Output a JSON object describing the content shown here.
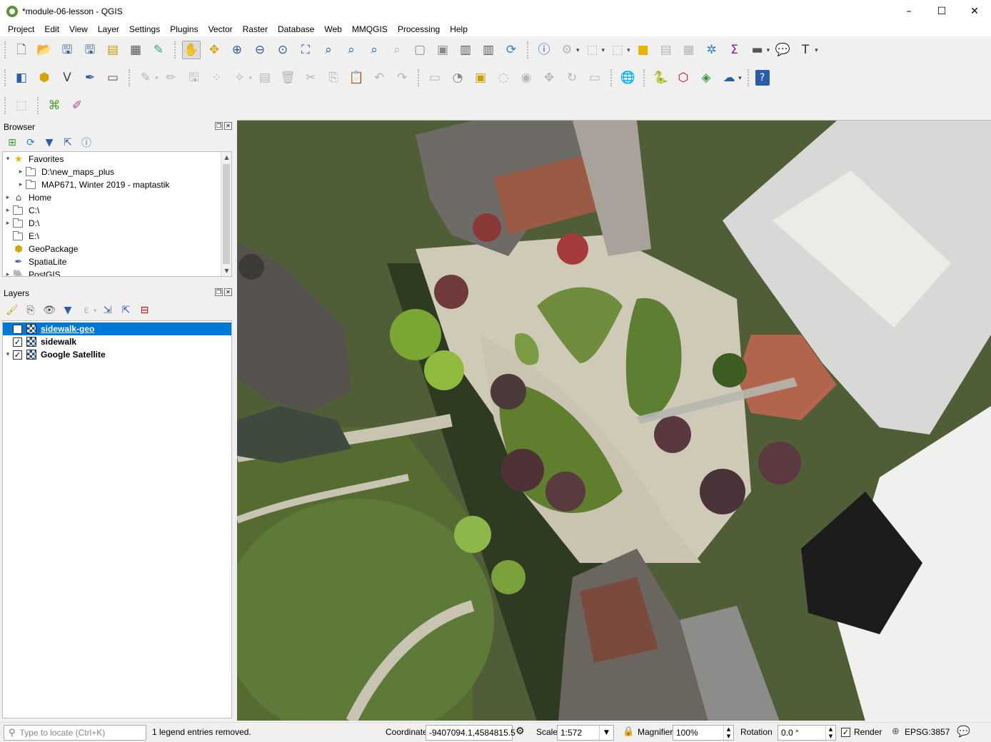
{
  "window": {
    "title": "*module-06-lesson - QGIS",
    "controls": [
      "–",
      "☐",
      "✕"
    ]
  },
  "menu": [
    "Project",
    "Edit",
    "View",
    "Layer",
    "Settings",
    "Plugins",
    "Vector",
    "Raster",
    "Database",
    "Web",
    "MMQGIS",
    "Processing",
    "Help"
  ],
  "browser": {
    "title": "Browser",
    "items": [
      {
        "label": "Favorites",
        "icon": "star-icon",
        "level": 0,
        "arrow": "▾"
      },
      {
        "label": "D:\\new_maps_plus",
        "icon": "folder-icon",
        "level": 1,
        "arrow": "▸"
      },
      {
        "label": "MAP671, Winter 2019 - maptastik",
        "icon": "folder-icon",
        "level": 1,
        "arrow": "▸"
      },
      {
        "label": "Home",
        "icon": "home-icon",
        "level": 0,
        "arrow": "▸"
      },
      {
        "label": "C:\\",
        "icon": "drive-icon",
        "level": 0,
        "arrow": "▸"
      },
      {
        "label": "D:\\",
        "icon": "drive-icon",
        "level": 0,
        "arrow": "▸"
      },
      {
        "label": "E:\\",
        "icon": "drive-icon",
        "level": 0,
        "arrow": ""
      },
      {
        "label": "GeoPackage",
        "icon": "geopackage-icon",
        "level": 0,
        "arrow": ""
      },
      {
        "label": "SpatiaLite",
        "icon": "spatialite-icon",
        "level": 0,
        "arrow": ""
      },
      {
        "label": "PostGIS",
        "icon": "postgis-icon",
        "level": 0,
        "arrow": "▸"
      }
    ]
  },
  "layers": {
    "title": "Layers",
    "items": [
      {
        "label": "sidewalk-geo",
        "checked": true,
        "selected": true
      },
      {
        "label": "sidewalk",
        "checked": true,
        "selected": false
      },
      {
        "label": "Google Satellite",
        "checked": true,
        "selected": false
      }
    ]
  },
  "status": {
    "locate_placeholder": "Type to locate (Ctrl+K)",
    "message": "1 legend entries removed.",
    "coordinate_label": "Coordinate",
    "coordinate_value": "-9407094.1,4584815.5",
    "scale_label": "Scale",
    "scale_value": "1:572",
    "magnifier_label": "Magnifier",
    "magnifier_value": "100%",
    "rotation_label": "Rotation",
    "rotation_value": "0.0 °",
    "render_label": "Render",
    "crs": "EPSG:3857"
  }
}
